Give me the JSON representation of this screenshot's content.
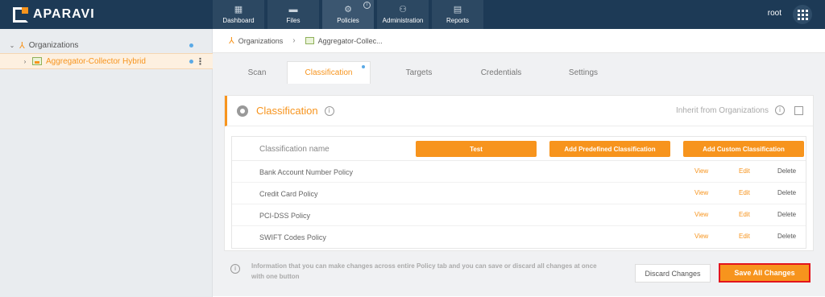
{
  "app": {
    "brand": "APARAVI"
  },
  "topnav": {
    "items": [
      {
        "label": "Dashboard",
        "icon": "dashboard-icon"
      },
      {
        "label": "Files",
        "icon": "folder-icon"
      },
      {
        "label": "Policies",
        "icon": "gear-icon",
        "active": true
      },
      {
        "label": "Administration",
        "icon": "users-icon"
      },
      {
        "label": "Reports",
        "icon": "clipboard-icon"
      }
    ],
    "user": "root"
  },
  "sidebar": {
    "root_label": "Organizations",
    "child_label": "Aggregator-Collector Hybrid"
  },
  "breadcrumb": {
    "items": [
      "Organizations",
      "Aggregator-Collec..."
    ]
  },
  "tabs": [
    "Scan",
    "Classification",
    "Targets",
    "Credentials",
    "Settings"
  ],
  "panel": {
    "title": "Classification",
    "inherit_label": "Inherit from Organizations"
  },
  "table": {
    "header": "Classification name",
    "buttons": {
      "test": "Test",
      "predefined": "Add Predefined Classification",
      "custom": "Add Custom Classification"
    },
    "rows": [
      {
        "name": "Bank Account Number Policy",
        "view": "View",
        "edit": "Edit",
        "delete": "Delete"
      },
      {
        "name": "Credit Card Policy",
        "view": "View",
        "edit": "Edit",
        "delete": "Delete"
      },
      {
        "name": "PCI-DSS Policy",
        "view": "View",
        "edit": "Edit",
        "delete": "Delete"
      },
      {
        "name": "SWIFT Codes Policy",
        "view": "View",
        "edit": "Edit",
        "delete": "Delete"
      }
    ]
  },
  "footer": {
    "info": "Information that you can make changes across entire Policy tab and you can save or discard all changes at once with one button",
    "discard": "Discard Changes",
    "save": "Save All Changes"
  },
  "colors": {
    "accent": "#f7941d",
    "topbar": "#1d3a56",
    "highlight": "#e3141c"
  }
}
